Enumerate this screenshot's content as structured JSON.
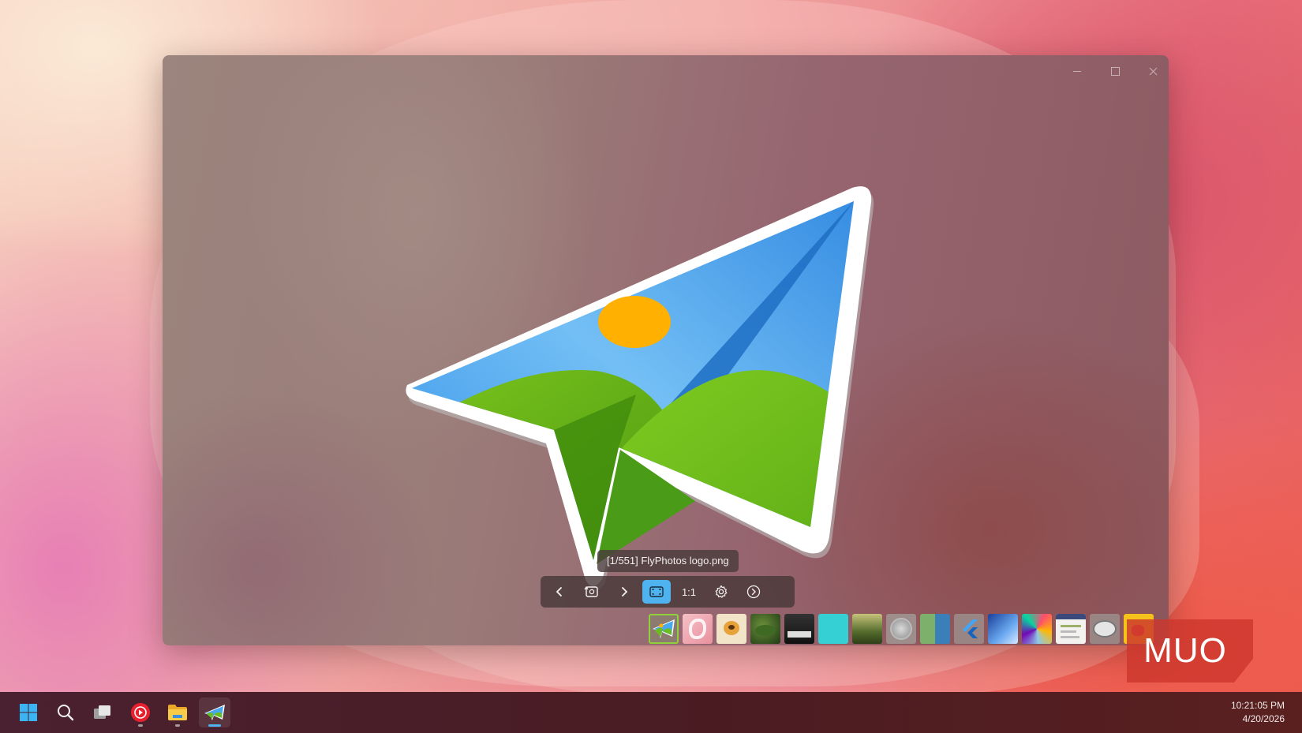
{
  "window": {
    "controls": {
      "minimize": "minimize-icon",
      "maximize": "maximize-icon",
      "close": "close-icon"
    }
  },
  "viewer": {
    "caption": "[1/551] FlyPhotos logo.png",
    "image": {
      "subject": "paper-plane-photo-logo",
      "colors": {
        "sky": "#4aa8ee",
        "sun": "#ffb000",
        "hills": "#6cbc1f"
      }
    }
  },
  "toolbar": {
    "buttons": [
      {
        "name": "previous",
        "icon": "chevron-left-icon"
      },
      {
        "name": "rotate",
        "icon": "rotate-photo-icon"
      },
      {
        "name": "next",
        "icon": "chevron-right-icon"
      },
      {
        "name": "fit-to-window",
        "icon": "fit-screen-icon",
        "active": true
      },
      {
        "name": "actual-size",
        "label": "1:1"
      },
      {
        "name": "settings",
        "icon": "gear-icon"
      },
      {
        "name": "slideshow",
        "icon": "play-circle-icon"
      }
    ],
    "actual_size_label": "1:1",
    "accent": "#4fb3f0"
  },
  "thumbnails": {
    "selected_index": 0,
    "selected_color": "#8fd13b",
    "count_visible": 15,
    "items": [
      "flyphotos-logo",
      "ios-16",
      "cat-drawing",
      "green-leaves",
      "fortnite",
      "cyan-square",
      "forest",
      "coin",
      "green-blue-split",
      "flutter-logo",
      "windows-wallpaper",
      "colorful-splash",
      "document",
      "badge",
      "pikachu"
    ]
  },
  "watermark": {
    "text": "MUO"
  },
  "taskbar": {
    "icons": [
      {
        "name": "start",
        "icon": "windows-start-icon"
      },
      {
        "name": "search",
        "icon": "search-icon"
      },
      {
        "name": "task-view",
        "icon": "task-view-icon"
      },
      {
        "name": "youtube-music",
        "icon": "youtube-music-icon"
      },
      {
        "name": "file-explorer",
        "icon": "folder-icon"
      },
      {
        "name": "flyphotos",
        "icon": "flyphotos-icon",
        "active": true
      }
    ],
    "clock": {
      "time": "10:21:05 PM",
      "date": "4/20/2026"
    }
  }
}
